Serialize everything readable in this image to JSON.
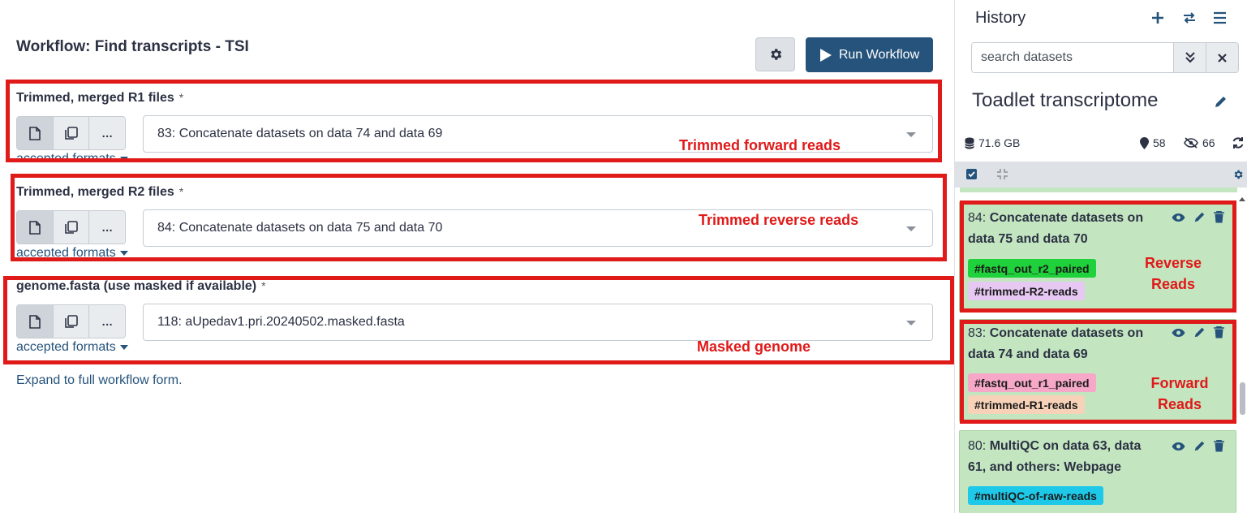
{
  "workflow": {
    "title": "Workflow: Find transcripts - TSI",
    "run_label": "Run Workflow",
    "expand_link": "Expand to full workflow form."
  },
  "params": [
    {
      "label": "Trimmed, merged R1 files",
      "required": "*",
      "value": "83: Concatenate datasets on data 74 and data 69",
      "formats": "accepted formats"
    },
    {
      "label": "Trimmed, merged R2 files",
      "required": "*",
      "value": "84: Concatenate datasets on data 75 and data 70",
      "formats": "accepted formats"
    },
    {
      "label": "genome.fasta (use masked if available)",
      "required": "*",
      "value": "118: aUpedav1.pri.20240502.masked.fasta",
      "formats": "accepted formats"
    }
  ],
  "annotations": {
    "forward": "Trimmed forward reads",
    "reverse": "Trimmed reverse reads",
    "masked": "Masked genome",
    "hist_reverse_1": "Reverse",
    "hist_reverse_2": "Reads",
    "hist_forward_1": "Forward",
    "hist_forward_2": "Reads"
  },
  "history": {
    "title": "History",
    "search_placeholder": "search datasets",
    "name": "Toadlet transcriptome",
    "size": "71.6 GB",
    "visible_count": "58",
    "hidden_count": "66",
    "datasets": [
      {
        "num": "84:",
        "title_line1": "Concatenate datasets on",
        "title_line2": "data 75 and data 70",
        "tags": [
          {
            "text": "#fastq_out_r2_paired",
            "color": "#1fd13a"
          },
          {
            "text": "#trimmed-R2-reads",
            "color": "#e6c8f2"
          }
        ]
      },
      {
        "num": "83:",
        "title_line1": "Concatenate datasets on",
        "title_line2": "data 74 and data 69",
        "tags": [
          {
            "text": "#fastq_out_r1_paired",
            "color": "#f7a8c8"
          },
          {
            "text": "#trimmed-R1-reads",
            "color": "#f7d2b8"
          }
        ]
      },
      {
        "num": "80:",
        "title_line1": "MultiQC on data 63, data",
        "title_line2": "61, and others: Webpage",
        "tags": [
          {
            "text": "#multiQC-of-raw-reads",
            "color": "#1ec8e8"
          }
        ]
      }
    ]
  },
  "colors": {
    "brand": "#25537b",
    "annotation": "#e01919",
    "dataset_ok": "#c3e6c0"
  }
}
